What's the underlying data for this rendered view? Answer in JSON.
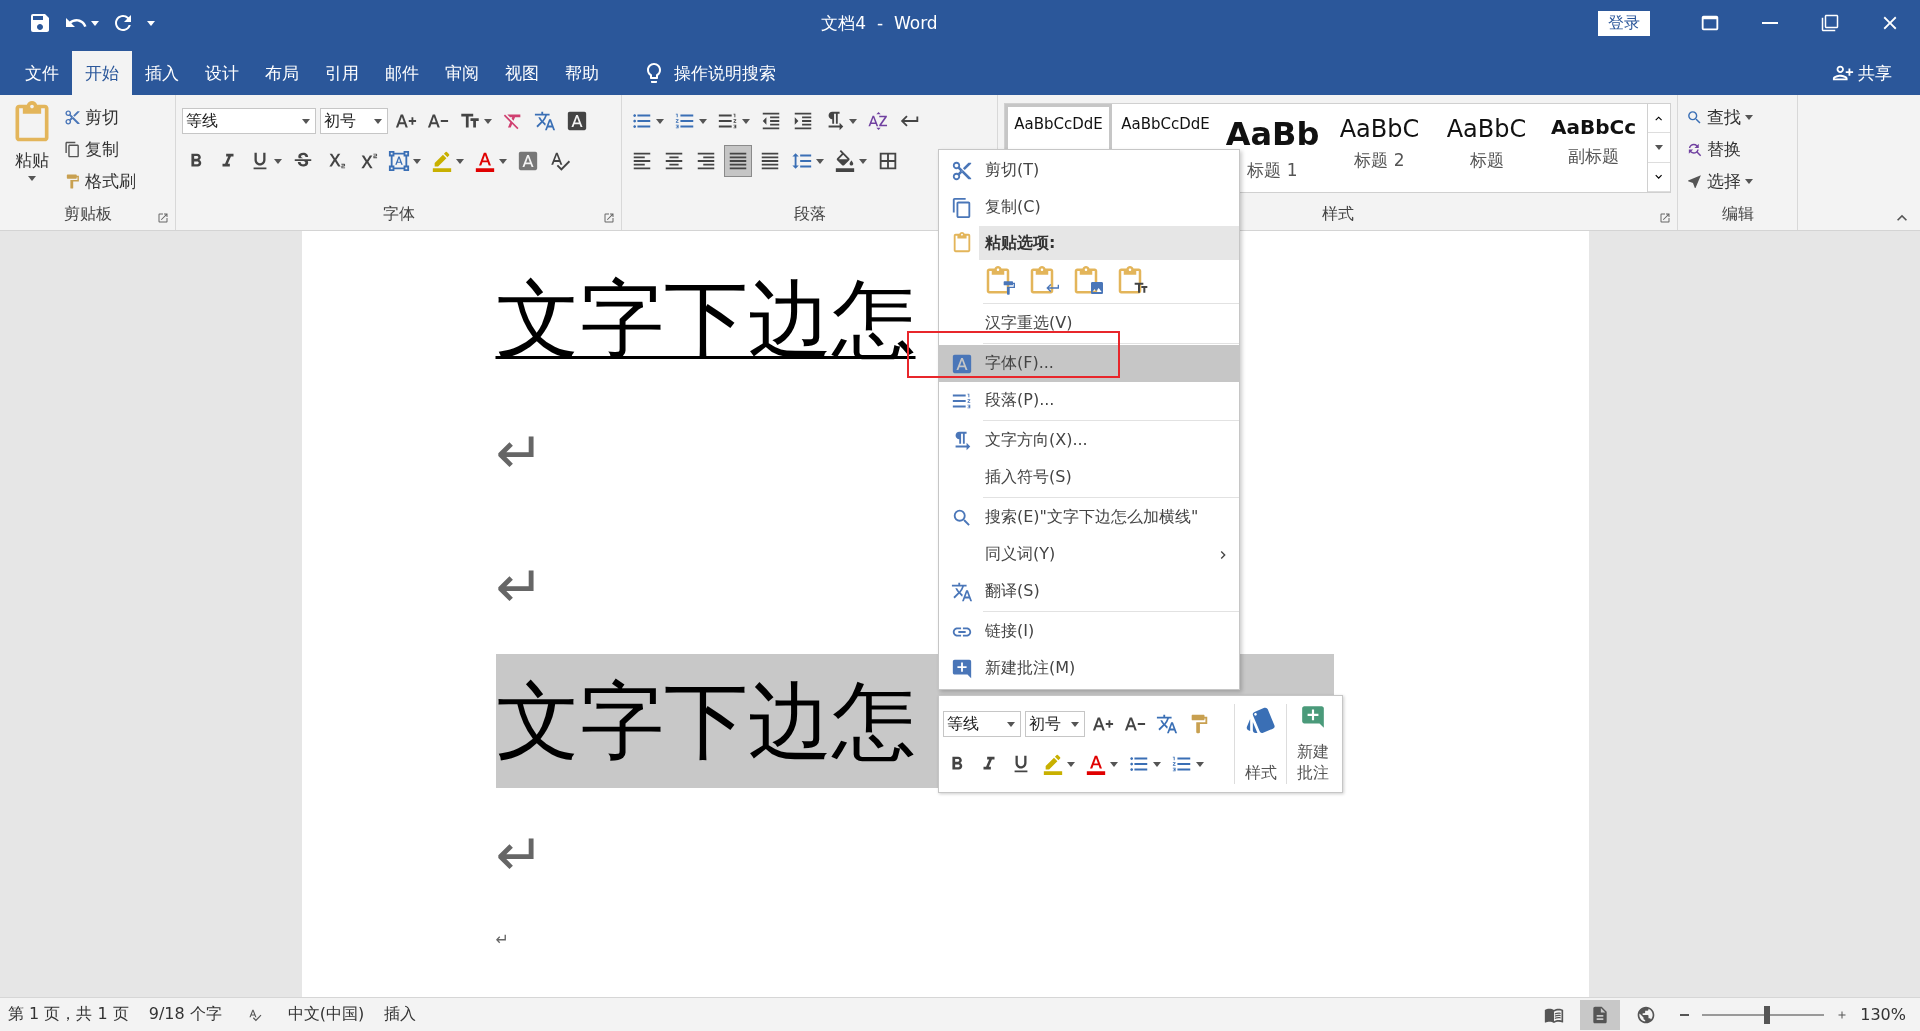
{
  "title_bar": {
    "title": "文档4  -  Word",
    "sign_in": "登录"
  },
  "tabs": [
    {
      "label": "文件",
      "selected": false
    },
    {
      "label": "开始",
      "selected": true
    },
    {
      "label": "插入",
      "selected": false
    },
    {
      "label": "设计",
      "selected": false
    },
    {
      "label": "布局",
      "selected": false
    },
    {
      "label": "引用",
      "selected": false
    },
    {
      "label": "邮件",
      "selected": false
    },
    {
      "label": "审阅",
      "selected": false
    },
    {
      "label": "视图",
      "selected": false
    },
    {
      "label": "帮助",
      "selected": false
    }
  ],
  "tell_me": "操作说明搜索",
  "share": "共享",
  "clipboard": {
    "paste": "粘贴",
    "cut": "剪切",
    "copy": "复制",
    "format_painter": "格式刷",
    "label": "剪贴板"
  },
  "font": {
    "name": "等线",
    "size": "初号",
    "label": "字体"
  },
  "paragraph": {
    "label": "段落",
    "alignment": [
      {
        "selected": false
      },
      {
        "selected": false
      },
      {
        "selected": false
      },
      {
        "selected": true
      },
      {
        "selected": false
      }
    ]
  },
  "styles": {
    "label": "样式",
    "gallery": [
      {
        "kind": "normal",
        "sample": "AaBbCcDdE",
        "selected": true
      },
      {
        "kind": "normal",
        "sample": "AaBbCcDdE",
        "selected": false
      },
      {
        "kind": "heading1",
        "sample": "AaBb",
        "name": "标题 1",
        "selected": false
      },
      {
        "kind": "heading2",
        "sample": "AaBbC",
        "name": "标题 2",
        "selected": false
      },
      {
        "kind": "title",
        "sample": "AaBbC",
        "name": "标题",
        "selected": false
      },
      {
        "kind": "subtitle",
        "sample": "AaBbCc",
        "name": "副标题",
        "selected": false
      }
    ]
  },
  "editing": {
    "find": "查找",
    "replace": "替换",
    "select": "选择",
    "label": "编辑"
  },
  "document": {
    "paragraphs": [
      {
        "kind": "text",
        "text": "文字下边怎",
        "underlined": true,
        "selected": false
      },
      {
        "kind": "mark",
        "text": "↵"
      },
      {
        "kind": "mark",
        "text": "↵"
      },
      {
        "kind": "text",
        "text": "文字下边怎",
        "underlined": false,
        "selected": true
      },
      {
        "kind": "mark",
        "text": "↵"
      },
      {
        "kind": "small_mark",
        "text": "↵"
      }
    ]
  },
  "context_menu": {
    "items": [
      {
        "kind": "item",
        "label": "剪切(T)",
        "selected": false,
        "submenu": false
      },
      {
        "kind": "item",
        "label": "复制(C)",
        "selected": false,
        "submenu": false
      },
      {
        "kind": "header",
        "label": "粘贴选项:"
      },
      {
        "kind": "paste_options"
      },
      {
        "kind": "separator"
      },
      {
        "kind": "item",
        "label": "汉字重选(V)",
        "selected": false,
        "submenu": false
      },
      {
        "kind": "separator"
      },
      {
        "kind": "item",
        "label": "字体(F)...",
        "selected": true,
        "submenu": false
      },
      {
        "kind": "item",
        "label": "段落(P)...",
        "selected": false,
        "submenu": false
      },
      {
        "kind": "separator"
      },
      {
        "kind": "item",
        "label": "文字方向(X)...",
        "selected": false,
        "submenu": false
      },
      {
        "kind": "item",
        "label": "插入符号(S)",
        "selected": false,
        "submenu": false
      },
      {
        "kind": "separator"
      },
      {
        "kind": "item",
        "label": "搜索(E)\"文字下边怎么加横线\"",
        "selected": false,
        "submenu": false
      },
      {
        "kind": "item",
        "label": "同义词(Y)",
        "selected": false,
        "submenu": true
      },
      {
        "kind": "item",
        "label": "翻译(S)",
        "selected": false,
        "submenu": false
      },
      {
        "kind": "separator"
      },
      {
        "kind": "item",
        "label": "链接(I)",
        "selected": false,
        "submenu": false
      },
      {
        "kind": "item",
        "label": "新建批注(M)",
        "selected": false,
        "submenu": false
      }
    ]
  },
  "mini_toolbar": {
    "font": "等线",
    "size": "初号",
    "styles": "样式",
    "new_comment": "新建批注"
  },
  "status_bar": {
    "page": "第 1 页，共 1 页",
    "words": "9/18 个字",
    "language": "中文(中国)",
    "mode": "插入",
    "views": [
      {
        "selected": false
      },
      {
        "selected": true
      },
      {
        "selected": false
      }
    ],
    "zoom": {
      "level": 0.53,
      "percent": "130%"
    }
  }
}
